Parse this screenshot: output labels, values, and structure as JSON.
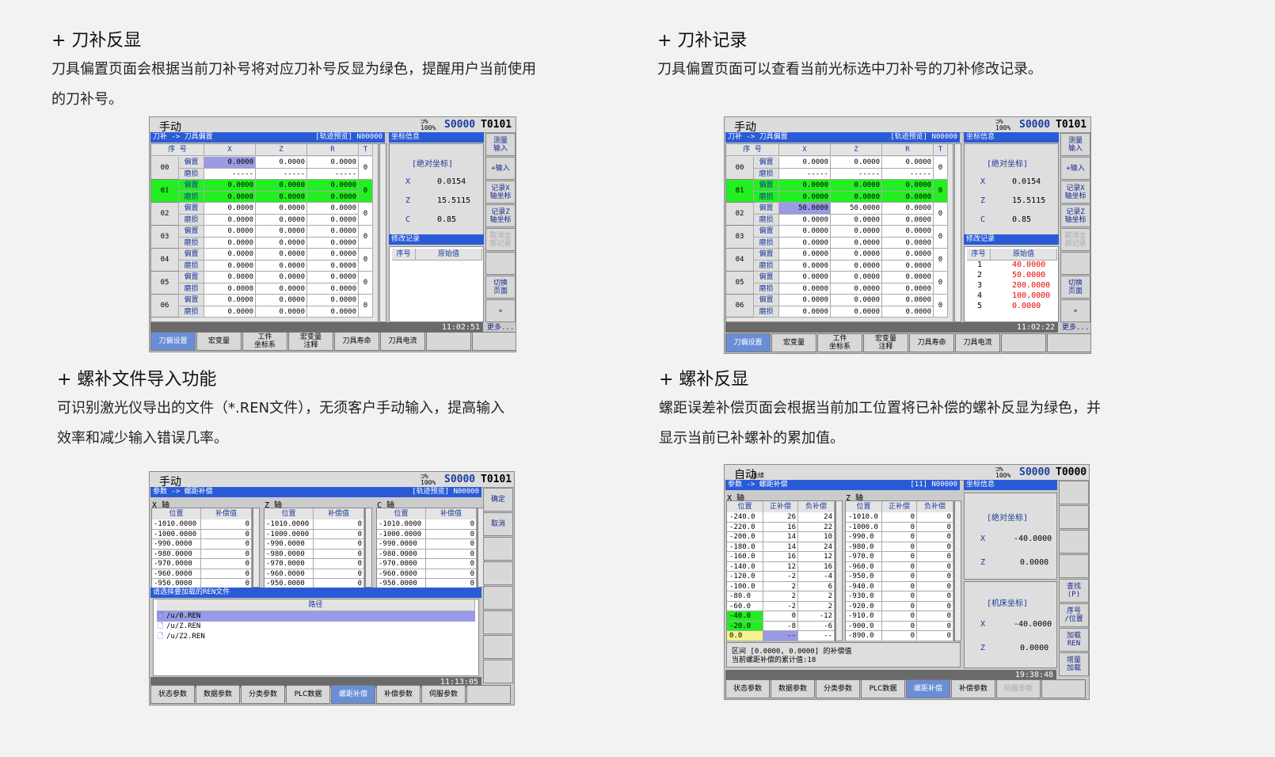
{
  "s1": {
    "title": "+ 刀补反显",
    "desc1": "刀具偏置页面会根据当前刀补号将对应刀补号反显为绿色，提醒用户当前使用",
    "desc2": "的刀补号。"
  },
  "s2": {
    "title": "+ 刀补记录",
    "desc1": "刀具偏置页面可以查看当前光标选中刀补号的刀补修改记录。"
  },
  "s3": {
    "title": "+ 螺补文件导入功能",
    "desc1": "可识别激光仪导出的文件（*.REN文件），无须客户手动输入，提高输入",
    "desc2": "效率和减少输入错误几率。"
  },
  "s4": {
    "title": "+ 螺补反显",
    "desc1": "螺距误差补偿页面会根据当前加工位置将已补偿的螺补反显为绿色，并",
    "desc2": "显示当前已补螺补的累加值。"
  },
  "common": {
    "speed": "100%",
    "s_value": "S0000",
    "t0101": "T0101",
    "t0000": "T0000",
    "mode_manual": "手动",
    "mode_auto": "自动",
    "mode_auto_sub": "连续"
  },
  "tool": {
    "bar": "刀补 -> 刀具偏置",
    "bar_right": "[轨迹预览] N00000",
    "coord_bar": "坐标信息",
    "headers": [
      "序 号",
      "X",
      "Z",
      "R",
      "T"
    ],
    "nums": [
      "00",
      "01",
      "02",
      "03",
      "04",
      "05",
      "06"
    ],
    "lbl_off": "偏置",
    "lbl_wear": "磨损",
    "val": "0.0000",
    "dash": "-----",
    "t0": "0",
    "t1": "0",
    "abs": "[绝对坐标]",
    "x": "X",
    "z": "Z",
    "c": "C",
    "xv": "0.0154",
    "zv": "15.5115",
    "cv": "0.85",
    "rec_bar": "修改记录",
    "rec_h1": "序号",
    "rec_h2": "原始值",
    "soft": [
      "测量\n输入",
      "+输入",
      "记录X\n轴坐标",
      "记录Z\n轴坐标",
      "取消全\n部记录",
      "",
      "切换\n页面",
      "»"
    ],
    "more": "更多...",
    "time1": "11:02:51",
    "time2": "11:02:22",
    "tabs": [
      "刀偏设置",
      "宏变量",
      "工件\n坐标系",
      "宏变量\n注释",
      "刀具寿命",
      "刀具电流",
      "",
      ""
    ],
    "v50": "50.0000",
    "records": [
      [
        "1",
        "40.0000"
      ],
      [
        "2",
        "50.0000"
      ],
      [
        "3",
        "200.0000"
      ],
      [
        "4",
        "100.0000"
      ],
      [
        "5",
        "0.0000"
      ]
    ]
  },
  "screw": {
    "bar": "参数 -> 螺距补偿",
    "bar_right": "[轨迹预览] N00000",
    "xa": "X 轴",
    "za": "Z 轴",
    "ca": "C 轴",
    "pos": "位置",
    "comp": "补偿值",
    "rows": [
      "-1010.0000",
      "-1000.0000",
      "-990.0000",
      "-980.0000",
      "-970.0000",
      "-960.0000",
      "-950.0000"
    ],
    "zero": "0",
    "file_bar": "请选择要加载的REN文件",
    "path": "路径",
    "files": [
      "/u/0.REN",
      "/u/Z.REN",
      "/u/Z2.REN"
    ],
    "soft": [
      "确定",
      "取消",
      "",
      "",
      "",
      "",
      "",
      ""
    ],
    "time": "11:13:05",
    "tabs": [
      "状态参数",
      "数据参数",
      "分类参数",
      "PLC数据",
      "螺距补偿",
      "补偿参数",
      "伺服参数",
      ""
    ]
  },
  "screw2": {
    "bar": "参数 -> 螺距补偿",
    "bar_right": "[11] N00000",
    "coord_bar": "坐标信息",
    "xa": "X 轴",
    "za": "Z 轴",
    "pos": "位置",
    "pc": "正补偿",
    "nc": "负补偿",
    "xrows": [
      [
        "-240.0",
        "26",
        "24"
      ],
      [
        "-220.0",
        "16",
        "22"
      ],
      [
        "-200.0",
        "14",
        "10"
      ],
      [
        "-180.0",
        "14",
        "24"
      ],
      [
        "-160.0",
        "16",
        "12"
      ],
      [
        "-140.0",
        "12",
        "16"
      ],
      [
        "-120.0",
        "-2",
        "-4"
      ],
      [
        "-100.0",
        "2",
        "6"
      ],
      [
        "-80.0",
        "2",
        "2"
      ],
      [
        "-60.0",
        "-2",
        "2"
      ],
      [
        "-40.0",
        "0",
        "-12"
      ],
      [
        "-20.0",
        "-8",
        "-6"
      ],
      [
        "0.0",
        "--",
        "--"
      ]
    ],
    "zrows": [
      "-1010.0",
      "-1000.0",
      "-990.0",
      "-980.0",
      "-970.0",
      "-960.0",
      "-950.0",
      "-940.0",
      "-930.0",
      "-920.0",
      "-910.0",
      "-900.0",
      "-890.0"
    ],
    "zero": "0",
    "note1": "区间 [0.0000, 0.0000] 的补偿值",
    "note2": "当前螺距补偿的累计值:18",
    "abs": "[绝对坐标]",
    "mach": "[机床坐标]",
    "x": "X",
    "z": "Z",
    "xv": "-40.0000",
    "zv": "0.0000",
    "soft": [
      "",
      "",
      "",
      "",
      "查找\n(P)",
      "序号\n/位置",
      "加载\nREN",
      "增量\n加载"
    ],
    "time": "19:38:48",
    "tabs": [
      "状态参数",
      "数据参数",
      "分类参数",
      "PLC数据",
      "螺距补偿",
      "补偿参数",
      "伺服参数",
      ""
    ]
  }
}
